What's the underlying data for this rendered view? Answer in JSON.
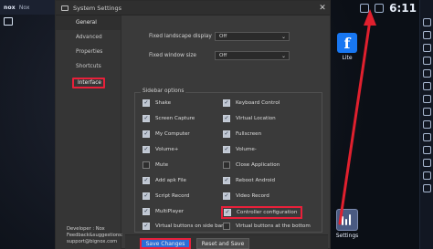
{
  "nox": {
    "brand": "nox",
    "label": "Nox"
  },
  "status": {
    "time": "6:11"
  },
  "desktop_apps": [
    {
      "id": "facebook",
      "label": "Lite"
    },
    {
      "id": "settings",
      "label": "Settings"
    }
  ],
  "window": {
    "title": "System Settings",
    "nav": [
      {
        "label": "General"
      },
      {
        "label": "Advanced"
      },
      {
        "label": "Properties"
      },
      {
        "label": "Shortcuts"
      },
      {
        "label": "Interface"
      }
    ],
    "developer": [
      "Developer : Nox",
      "Feedback&suggestions:",
      "support@bignox.com"
    ],
    "settings": [
      {
        "label": "Fixed landscape display",
        "value": "Off"
      },
      {
        "label": "Fixed window size",
        "value": "Off"
      }
    ],
    "sidebar_options": {
      "legend": "Sidebar options",
      "left": [
        {
          "label": "Shake",
          "checked": true
        },
        {
          "label": "Screen Capture",
          "checked": true
        },
        {
          "label": "My Computer",
          "checked": true
        },
        {
          "label": "Volume+",
          "checked": true
        },
        {
          "label": "Mute",
          "checked": false
        },
        {
          "label": "Add apk File",
          "checked": true
        },
        {
          "label": "Script Record",
          "checked": true
        },
        {
          "label": "MultiPlayer",
          "checked": true
        }
      ],
      "right": [
        {
          "label": "Keyboard Control",
          "checked": true
        },
        {
          "label": "Virtual Location",
          "checked": true
        },
        {
          "label": "Fullscreen",
          "checked": true
        },
        {
          "label": "Volume-",
          "checked": true
        },
        {
          "label": "Close Application",
          "checked": false
        },
        {
          "label": "Reboot Android",
          "checked": true
        },
        {
          "label": "Video Record",
          "checked": true
        },
        {
          "label": "Controller configuration",
          "checked": true
        }
      ],
      "bottom": [
        {
          "label": "Virtual buttons on side bar",
          "checked": true
        },
        {
          "label": "Virtual buttons at the bottom",
          "checked": false
        }
      ]
    },
    "buttons": {
      "save": "Save Changes",
      "reset": "Reset and Save"
    }
  }
}
